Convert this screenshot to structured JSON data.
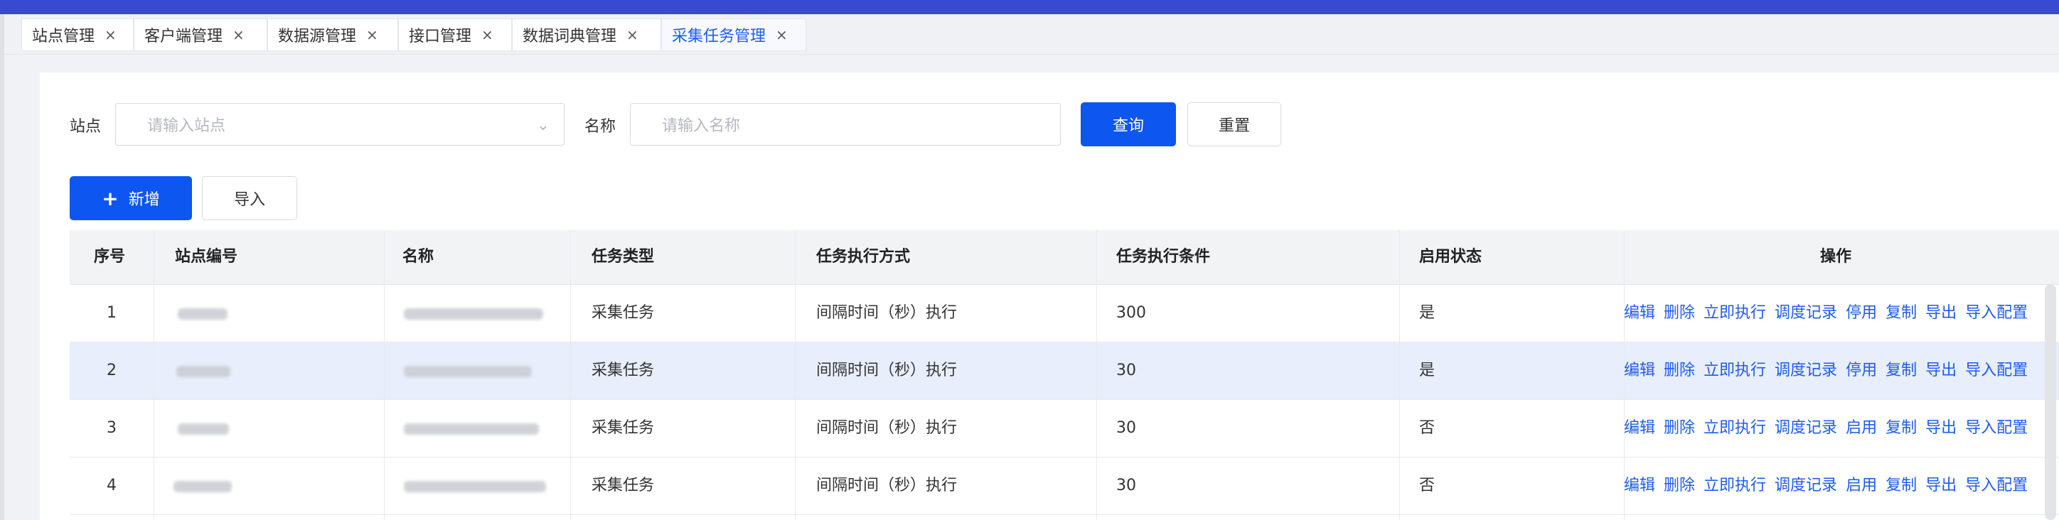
{
  "tabs": [
    {
      "label": "站点管理",
      "close": "×"
    },
    {
      "label": "客户端管理",
      "close": "×"
    },
    {
      "label": "数据源管理",
      "close": "×"
    },
    {
      "label": "接口管理",
      "close": "×"
    },
    {
      "label": "数据词典管理",
      "close": "×"
    },
    {
      "label": "采集任务管理",
      "close": "×"
    }
  ],
  "search": {
    "site_label": "站点",
    "site_placeholder": "请输入站点",
    "name_label": "名称",
    "name_placeholder": "请输入名称",
    "query": "查询",
    "reset": "重置"
  },
  "toolbar": {
    "add": "新增",
    "plus": "+",
    "import": "导入"
  },
  "table": {
    "headers": [
      "序号",
      "站点编号",
      "名称",
      "任务类型",
      "任务执行方式",
      "任务执行条件",
      "启用状态",
      "操作"
    ],
    "rows": [
      {
        "index": "1",
        "type": "采集任务",
        "mode": "间隔时间（秒）执行",
        "condition": "300",
        "enabled": "是",
        "ops": [
          "编辑",
          "删除",
          "立即执行",
          "调度记录",
          "停用",
          "复制",
          "导出",
          "导入配置"
        ]
      },
      {
        "index": "2",
        "type": "采集任务",
        "mode": "间隔时间（秒）执行",
        "condition": "30",
        "enabled": "是",
        "ops": [
          "编辑",
          "删除",
          "立即执行",
          "调度记录",
          "停用",
          "复制",
          "导出",
          "导入配置"
        ]
      },
      {
        "index": "3",
        "type": "采集任务",
        "mode": "间隔时间（秒）执行",
        "condition": "30",
        "enabled": "否",
        "ops": [
          "编辑",
          "删除",
          "立即执行",
          "调度记录",
          "启用",
          "复制",
          "导出",
          "导入配置"
        ]
      },
      {
        "index": "4",
        "type": "采集任务",
        "mode": "间隔时间（秒）执行",
        "condition": "30",
        "enabled": "否",
        "ops": [
          "编辑",
          "删除",
          "立即执行",
          "调度记录",
          "启用",
          "复制",
          "导出",
          "导入配置"
        ]
      }
    ]
  },
  "colors": {
    "primary": "#0d56f0",
    "topbar": "#3a4ad0",
    "link": "#1e5bf0",
    "highlight_row": "#e8eefc"
  }
}
